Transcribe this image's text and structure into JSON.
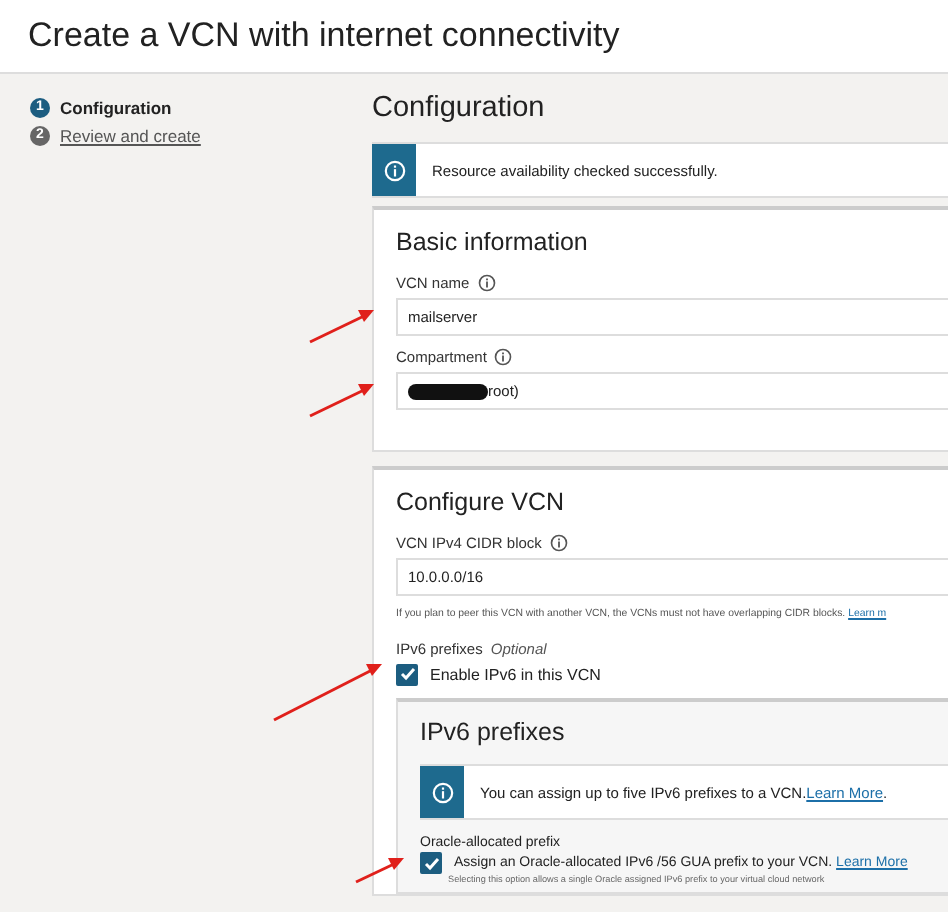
{
  "page_title": "Create a VCN with internet connectivity",
  "steps": [
    {
      "number": "1",
      "label": "Configuration",
      "selected": true
    },
    {
      "number": "2",
      "label": "Review and create",
      "selected": false
    }
  ],
  "heading": "Configuration",
  "banner": {
    "text": "Resource availability checked successfully."
  },
  "basic_information": {
    "title": "Basic information",
    "fields": [
      {
        "label": "VCN name",
        "value": "mailserver",
        "redacted": false,
        "pointed_at": true
      },
      {
        "label": "Compartment",
        "value": "root)",
        "redacted": true,
        "pointed_at": true
      }
    ]
  },
  "configure_vcn": {
    "title": "Configure VCN",
    "cidr": {
      "label": "VCN IPv4 CIDR block",
      "value": "10.0.0.0/16"
    },
    "help": {
      "text": "If you plan to peer this VCN with another VCN, the VCNs must not have overlapping CIDR blocks.",
      "link": "Learn m"
    },
    "ipv6_label": "IPv6 prefixes",
    "ipv6_optional": "Optional",
    "enable_ipv6": {
      "label": "Enable IPv6 in this VCN",
      "checked": true,
      "pointed_at": true
    },
    "ipv6_section": {
      "title": "IPv6 prefixes",
      "banner": {
        "text": "You can assign up to five IPv6 prefixes to a VCN.",
        "link": "Learn More",
        "after": "."
      },
      "prefix_label": "Oracle-allocated prefix",
      "assign": {
        "label": "Assign an Oracle-allocated IPv6 /56 GUA prefix to your VCN.",
        "link": "Learn More",
        "checked": true,
        "pointed_at": true
      },
      "assign_help": "Selecting this option allows a single Oracle assigned IPv6 prefix to your virtual cloud network"
    }
  }
}
